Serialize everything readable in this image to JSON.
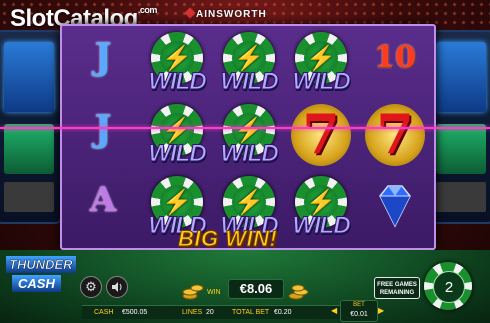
{
  "brand": {
    "name": "SlotCatalog",
    "suffix": ".com"
  },
  "maker": "AINSWORTH",
  "reels": [
    [
      "J",
      "J",
      "A"
    ],
    [
      "WILD",
      "WILD",
      "WILD"
    ],
    [
      "WILD",
      "WILD",
      "WILD"
    ],
    [
      "WILD",
      "7",
      "WILD"
    ],
    [
      "10",
      "7",
      "diamond"
    ]
  ],
  "wild_label": "WILD",
  "big_win": "BIG WIN!",
  "game_logo": {
    "line1": "THUNDER",
    "line2": "CASH"
  },
  "win": {
    "label": "WIN",
    "value": "€8.06"
  },
  "info": {
    "cash_label": "CASH",
    "cash_value": "€500.05",
    "lines_label": "LINES",
    "lines_value": "20",
    "total_bet_label": "TOTAL BET",
    "total_bet_value": "€0.20"
  },
  "free_games": {
    "line1": "FREE GAMES",
    "line2": "REMAINING"
  },
  "free_games_count": "2",
  "bet": {
    "label": "BET",
    "value": "€0.01"
  },
  "colors": {
    "payline": "#ff3cc8",
    "accent": "#ffd21a",
    "felt": "#1f7a3a"
  }
}
